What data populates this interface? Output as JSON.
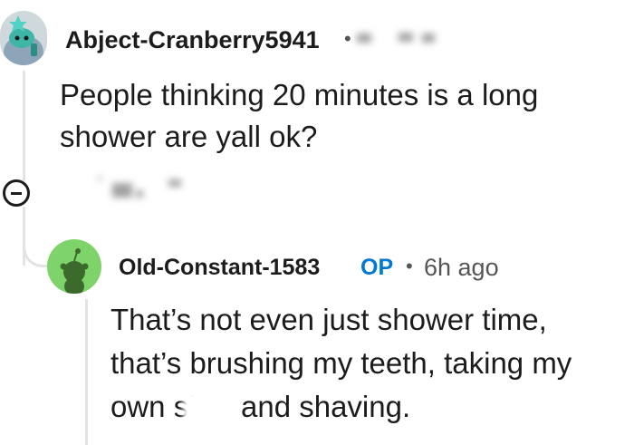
{
  "comments": [
    {
      "username": "Abject-Cranberry5941",
      "separator": "•",
      "body_line1": "People thinking 20 minutes is a long",
      "body_line2": "shower are yall ok?"
    },
    {
      "username": "Old-Constant-1583",
      "op_badge": "OP",
      "separator": "•",
      "timestamp": "6h ago",
      "body_line1": "That’s not even just shower time,",
      "body_line2": "that’s brushing my teeth, taking my",
      "body_line3a": "own sh",
      "body_line3b": "and shaving."
    }
  ],
  "colors": {
    "op_badge": "#0079d3",
    "avatar1_bg": "#cfd8dc",
    "avatar2_bg": "#7ed36a",
    "thread_line": "#e3e3e3"
  },
  "icons": {
    "collapse": "collapse-minus-icon"
  }
}
